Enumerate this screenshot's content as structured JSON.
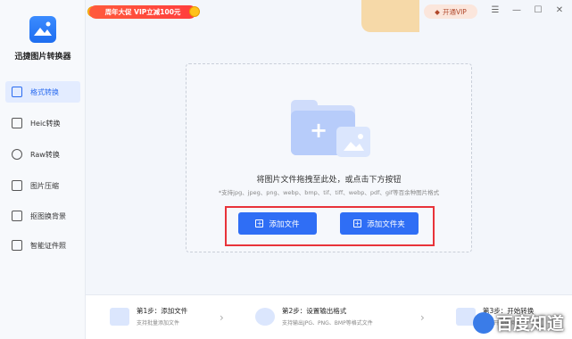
{
  "app": {
    "name": "迅捷图片转换器"
  },
  "sidebar": {
    "items": [
      {
        "label": "格式转换",
        "icon": "image-convert-icon",
        "active": true
      },
      {
        "label": "Heic转换",
        "icon": "heic-icon",
        "active": false
      },
      {
        "label": "Raw转换",
        "icon": "raw-icon",
        "active": false
      },
      {
        "label": "图片压缩",
        "icon": "compress-icon",
        "active": false
      },
      {
        "label": "抠图换背景",
        "icon": "cutout-icon",
        "active": false
      },
      {
        "label": "智能证件照",
        "icon": "id-photo-icon",
        "active": false
      }
    ]
  },
  "topbar": {
    "promo": "周年大促 VIP立减100元",
    "vip_button": "开通VIP",
    "vip_icon": "diamond-icon"
  },
  "drop_area": {
    "main_text": "将图片文件拖拽至此处，或点击下方按钮",
    "sub_text": "*支持jpg、jpeg、png、webp、bmp、tif、tiff、webp、pdf、gif等百余种图片格式",
    "add_file_button": "添加文件",
    "add_folder_button": "添加文件夹"
  },
  "steps": [
    {
      "title": "第1步：添加文件",
      "desc": "支持批量添加文件"
    },
    {
      "title": "第2步：设置输出格式",
      "desc": "支持输出JPG、PNG、BMP等格式文件"
    },
    {
      "title": "第3步：开始转换",
      "desc": "点击开始转换"
    }
  ],
  "watermark": "百度知道",
  "colors": {
    "accent": "#2f6ef5",
    "highlight": "#e8333a"
  }
}
